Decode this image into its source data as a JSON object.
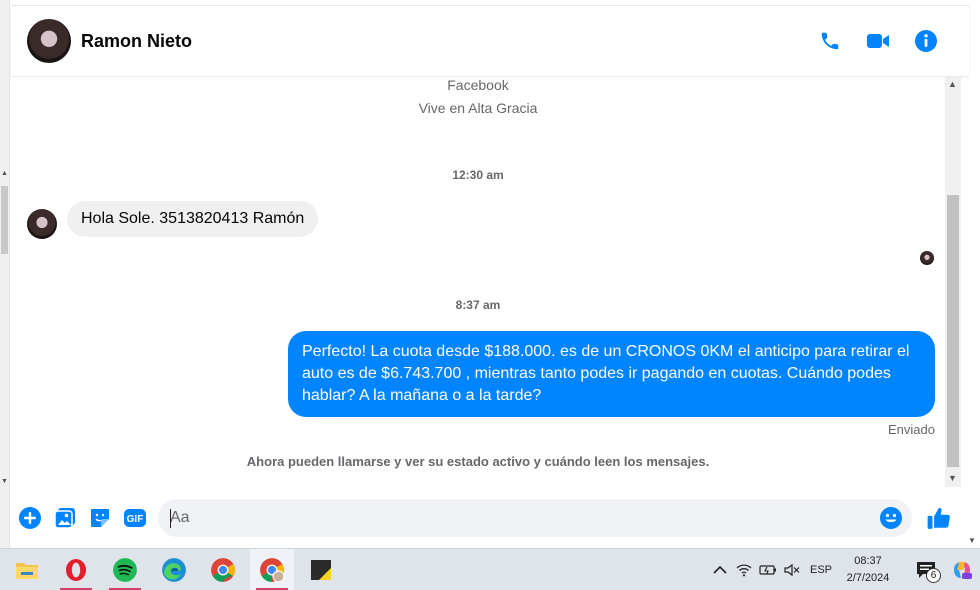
{
  "header": {
    "contact_name": "Ramon Nieto",
    "accent_color": "#0084ff"
  },
  "chat": {
    "profile_line1": "Facebook",
    "profile_line2": "Vive en Alta Gracia",
    "timestamp1": "12:30 am",
    "message_in": "Hola Sole. 3513820413 Ramón",
    "timestamp2": "8:37 am",
    "message_out": "Perfecto! La cuota desde $188.000. es de un CRONOS 0KM el anticipo para retirar el auto es de $6.743.700 , mientras tanto podes ir pagando en cuotas. Cuándo podes hablar? A la mañana o a la tarde?",
    "status_sent": "Enviado",
    "notice": "Ahora pueden llamarse y ver su estado activo y cuándo leen los mensajes."
  },
  "composer": {
    "placeholder": "Aa",
    "gif_label": "GIF"
  },
  "taskbar": {
    "apps": [
      "file-explorer",
      "opera",
      "spotify",
      "edge",
      "chrome",
      "chrome-profile",
      "sticky-notes"
    ],
    "language": "ESP",
    "time": "08:37",
    "date": "2/7/2024",
    "notification_count": "6"
  }
}
